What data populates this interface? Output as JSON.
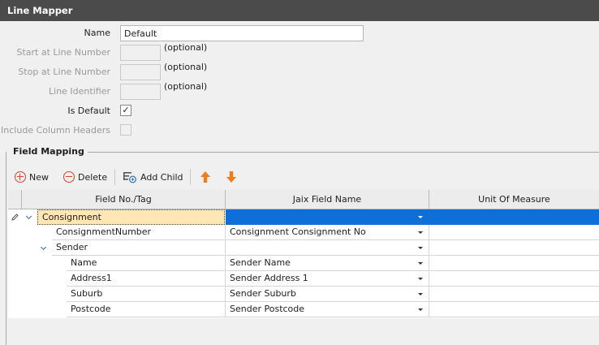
{
  "window": {
    "title": "Line Mapper"
  },
  "form": {
    "name_label": "Name",
    "name_value": "Default",
    "start_label": "Start at Line Number",
    "stop_label": "Stop at Line Number",
    "identifier_label": "Line Identifier",
    "optional_text": "(optional)",
    "is_default_label": "Is Default",
    "is_default_checked": true,
    "is_default_mark": "✓",
    "include_headers_label": "Include Column Headers",
    "include_headers_checked": false
  },
  "field_mapping": {
    "title": "Field Mapping",
    "toolbar": {
      "new_label": "New",
      "delete_label": "Delete",
      "add_child_label": "Add Child",
      "move_up_icon": "arrow-up-icon",
      "move_down_icon": "arrow-down-icon"
    },
    "columns": [
      "Field No./Tag",
      "Jaix Field Name",
      "Unit Of Measure"
    ],
    "rows": [
      {
        "tag": "Consignment",
        "field": "",
        "uom": "",
        "level": 0,
        "expanded": true,
        "selected": true
      },
      {
        "tag": "ConsignmentNumber",
        "field": "Consignment Consignment No",
        "uom": "",
        "level": 1
      },
      {
        "tag": "Sender",
        "field": "",
        "uom": "",
        "level": 1,
        "expanded": true
      },
      {
        "tag": "Name",
        "field": "Sender Name",
        "uom": "",
        "level": 2
      },
      {
        "tag": "Address1",
        "field": "Sender Address 1",
        "uom": "",
        "level": 2
      },
      {
        "tag": "Suburb",
        "field": "Sender Suburb",
        "uom": "",
        "level": 2
      },
      {
        "tag": "Postcode",
        "field": "Sender Postcode",
        "uom": "",
        "level": 2
      }
    ]
  },
  "colors": {
    "accent": "#0f6fd8",
    "selection": "#ffe6b4",
    "title_bar": "#4b4b4b",
    "arrows": "#f07d1a",
    "new_delete": "#d8442c"
  }
}
